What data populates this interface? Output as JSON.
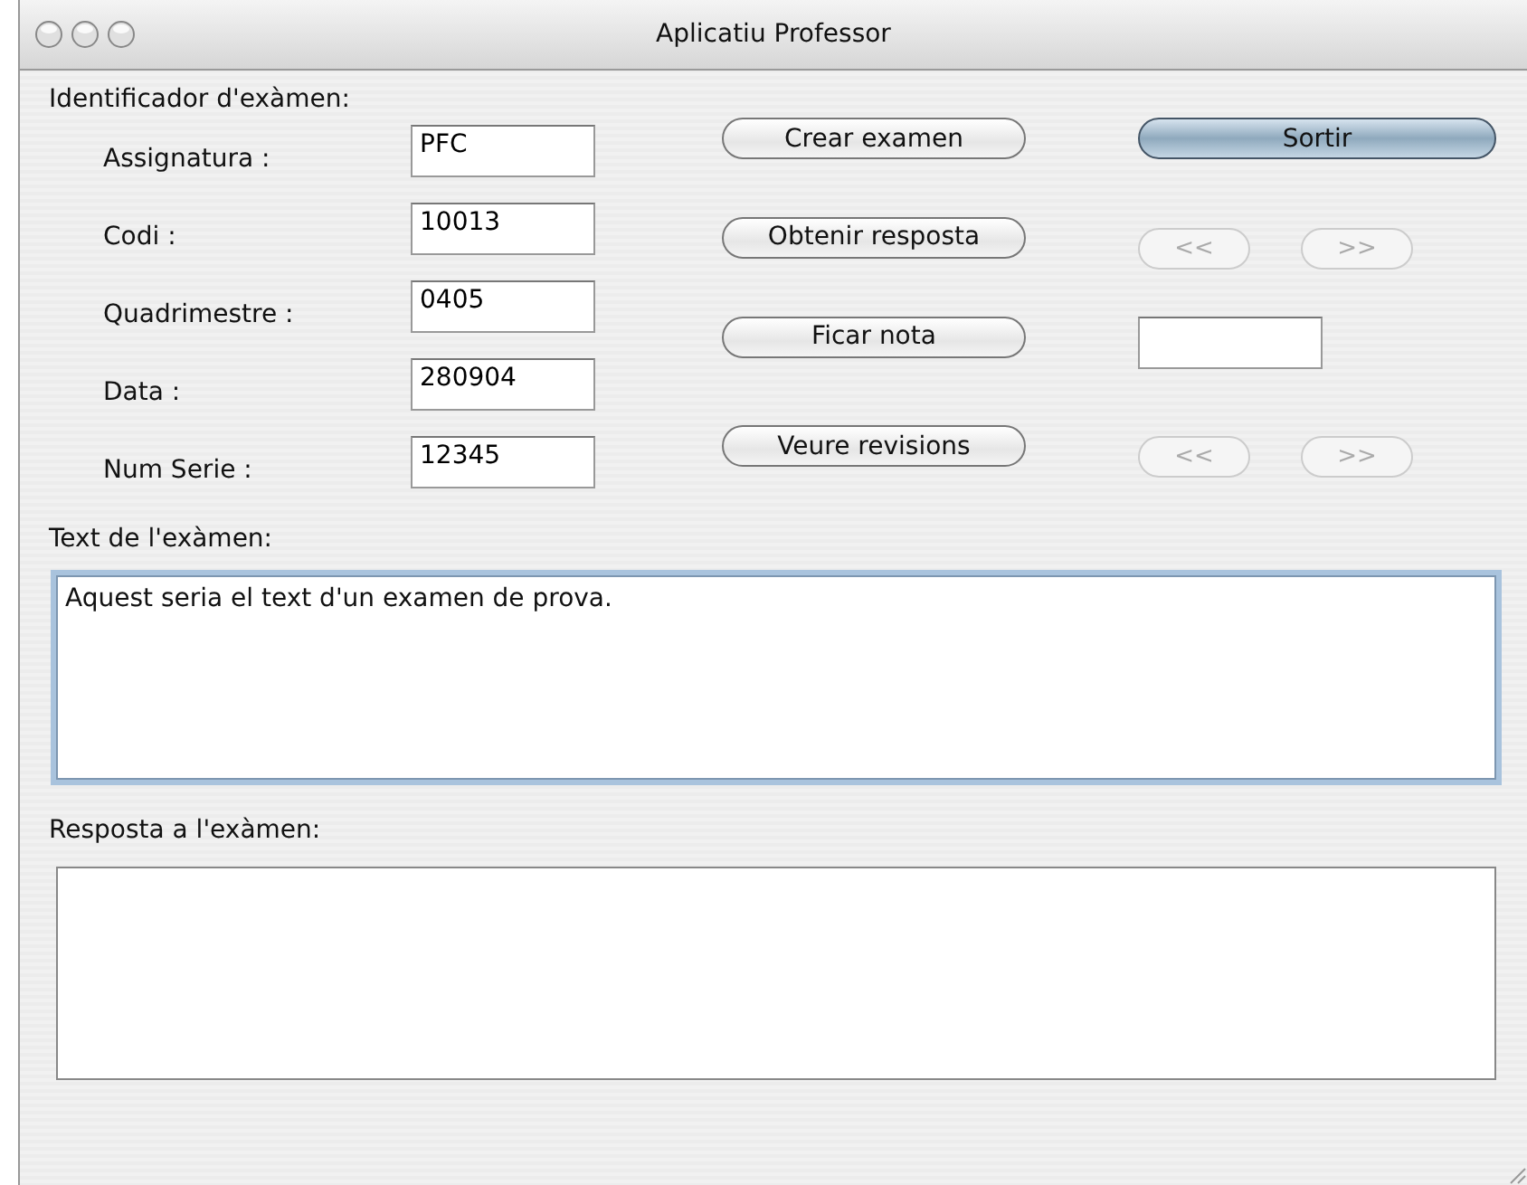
{
  "window": {
    "title": "Aplicatiu Professor"
  },
  "identifier": {
    "label": "Identificador d'exàmen:",
    "fields": [
      {
        "label": "Assignatura :",
        "value": "PFC"
      },
      {
        "label": "Codi :",
        "value": "10013"
      },
      {
        "label": "Quadrimestre :",
        "value": "0405"
      },
      {
        "label": "Data :",
        "value": "280904"
      },
      {
        "label": "Num Serie :",
        "value": "12345"
      }
    ]
  },
  "actions": [
    {
      "button": "Crear examen",
      "extra": {
        "kind": "button",
        "label": "Sortir",
        "default": true
      }
    },
    {
      "button": "Obtenir resposta",
      "extra": {
        "kind": "nav",
        "prev": "<<",
        "next": ">>",
        "disabled": true
      }
    },
    {
      "button": "Ficar nota",
      "extra": {
        "kind": "field"
      }
    },
    {
      "button": "Veure revisions",
      "extra": {
        "kind": "nav",
        "prev": "<<",
        "next": ">>",
        "disabled": true
      }
    }
  ],
  "exam_text": {
    "label": "Text de l'exàmen:",
    "value": "Aquest seria el text d'un examen de prova.",
    "focused": true
  },
  "answer": {
    "label": "Resposta a l'exàmen:",
    "focused": false
  }
}
